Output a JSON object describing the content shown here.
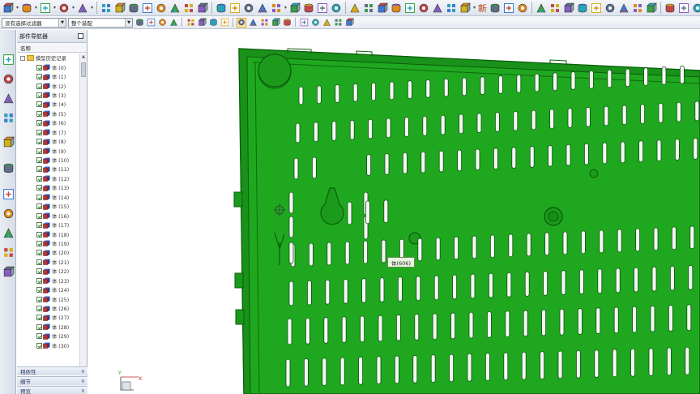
{
  "toolbar_row1": {
    "new_label": "新",
    "icons": [
      "block-icon",
      "cylinder-icon",
      "cone-icon",
      "sphere-icon",
      "extrude-icon",
      "grid-array-icon",
      "thicken-icon",
      "pattern-icon",
      "mirror-icon",
      "draft-icon",
      "fillet-icon",
      "shell-icon",
      "chamfer-icon",
      "trim-icon",
      "split-icon",
      "offset-icon",
      "hole-icon",
      "boss-icon",
      "pocket-icon",
      "pad-icon",
      "slot-icon",
      "groove-icon",
      "rib-icon",
      "sweep-icon",
      "tube-icon",
      "coil-icon",
      "emboss-icon",
      "unite-icon",
      "subtract-icon",
      "intersect-icon",
      "sew-icon",
      "patch-icon",
      "measure-icon",
      "section-icon",
      "analysis-icon",
      "move-face-icon",
      "replace-face-icon",
      "resize-icon",
      "delete-face-icon",
      "offset-face-icon",
      "draft-body-icon",
      "surface-icon",
      "box-icon",
      "cylinder-solid-icon",
      "face-icon",
      "curve-icon",
      "sketch-icon",
      "point-icon",
      "plane-icon",
      "axis-icon",
      "wcs-icon",
      "layer-icon"
    ]
  },
  "toolbar_row2": {
    "selection_filter": "没有选择过滤器",
    "assembly_scope": "整个装配"
  },
  "navigator": {
    "title": "部件导航器",
    "column_header": "名称",
    "root_label": "模型历史记录",
    "items": [
      "体 (0)",
      "体 (1)",
      "体 (2)",
      "体 (3)",
      "体 (4)",
      "体 (5)",
      "体 (6)",
      "体 (7)",
      "体 (8)",
      "体 (9)",
      "体 (10)",
      "体 (11)",
      "体 (12)",
      "体 (13)",
      "体 (14)",
      "体 (15)",
      "体 (16)",
      "体 (17)",
      "体 (18)",
      "体 (19)",
      "体 (20)",
      "体 (21)",
      "体 (22)",
      "体 (23)",
      "体 (24)",
      "体 (25)",
      "体 (26)",
      "体 (27)",
      "体 (28)",
      "体 (29)",
      "体 (30)"
    ],
    "panels": [
      "相依性",
      "细节",
      "预览"
    ]
  },
  "viewport": {
    "tooltip": "体(606)",
    "model_color": "#1fa81f",
    "model_edge_color": "#0b5e0b",
    "slot_color": "#f6f6f6",
    "triad_labels": [
      "X",
      "Y"
    ]
  }
}
